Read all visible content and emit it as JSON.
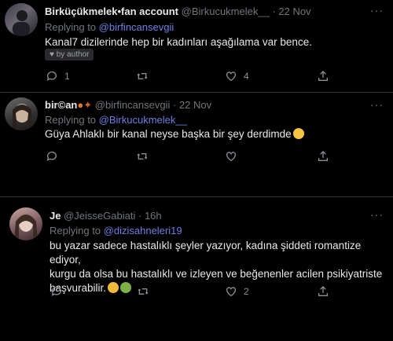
{
  "tweets": [
    {
      "name": "Birküçükmelek•fan account",
      "handle": "@Birkucukmelek__",
      "dot": "·",
      "time": "22 Nov",
      "replying_to_label": "Replying to",
      "replying_to": "@birfincansevgii",
      "text": "Kanal7 dizilerinde hep bir kadınları aşağılama var bence.",
      "badge": "by author",
      "replies": "1",
      "retweets": "",
      "likes": "4"
    },
    {
      "name": "bir©an",
      "handle": "@birfincansevgii",
      "dot": "·",
      "time": "22 Nov",
      "replying_to_label": "Replying to",
      "replying_to": "@Birkucukmelek__",
      "text": "Güya Ahlaklı  bir kanal neyse başka bir şey derdimde",
      "replies": "",
      "retweets": "",
      "likes": ""
    },
    {
      "name": "Je",
      "handle": "@JeisseGabiati",
      "dot": "·",
      "time": "16h",
      "replying_to_label": "Replying to",
      "replying_to": "@dizisahneleri19",
      "text_lines": [
        "bu yazar sadece hastalıklı şeyler yazıyor, kadına şiddeti romantize ediyor,",
        "kurgu da olsa bu hastalıklı ve izleyen ve beğenenler acilen psikiyatriste",
        "başvurabilir."
      ],
      "replies": "",
      "retweets": "",
      "likes": "2"
    }
  ],
  "more_label": "···"
}
